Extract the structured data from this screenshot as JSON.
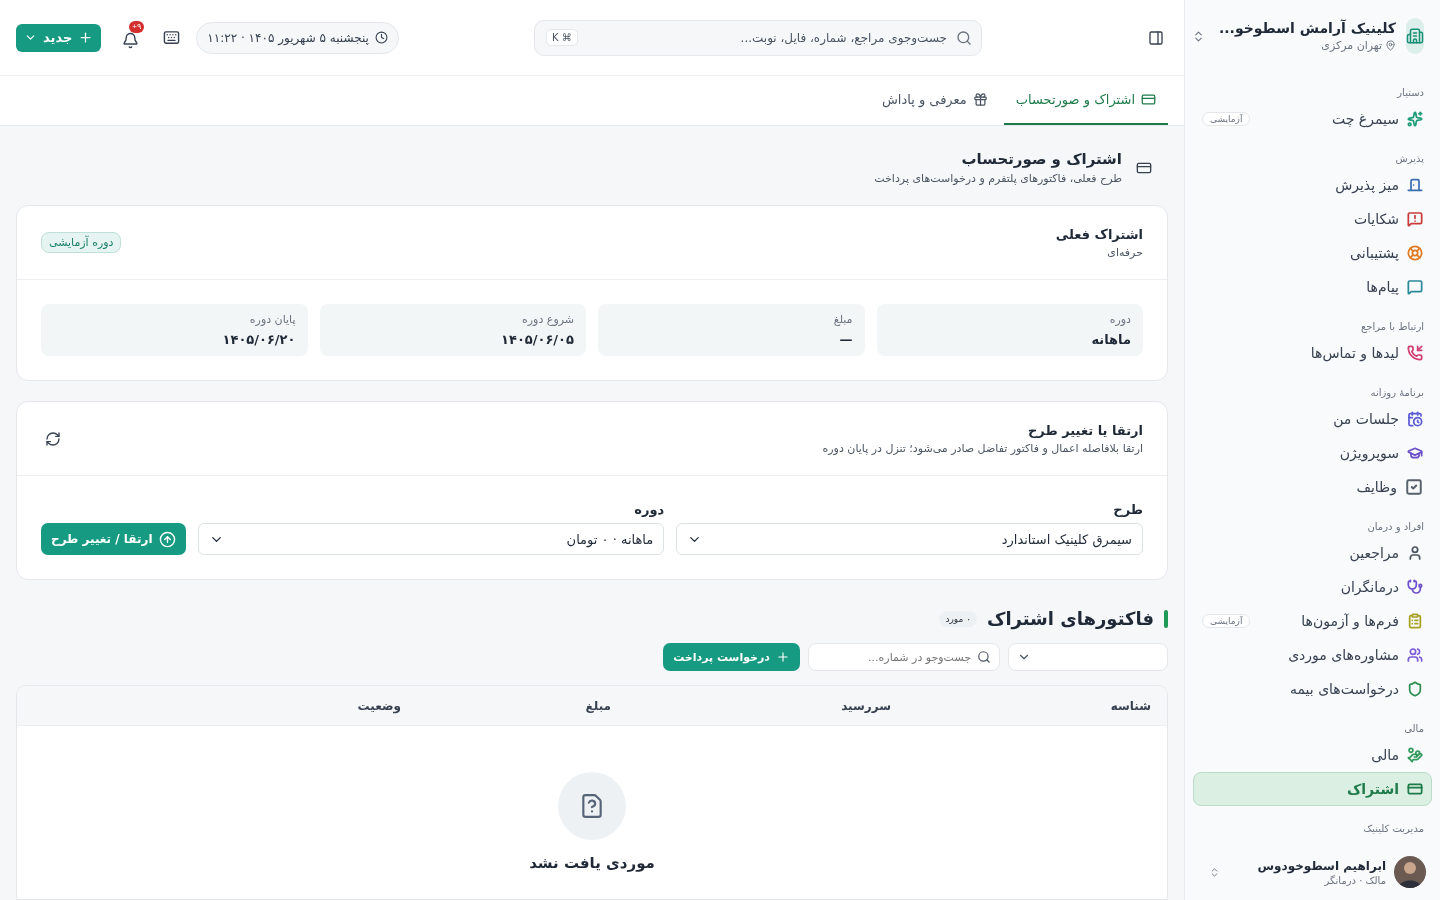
{
  "clinic": {
    "name": "کلینیک آرامش اسطوخو...",
    "location": "تهران مرکزی"
  },
  "sidebar": {
    "sections": [
      {
        "title": "دستیار",
        "items": [
          {
            "label": "سیمرغ چت",
            "badge": "آزمایشی",
            "color": "#1f9d7a",
            "selected": false
          }
        ]
      },
      {
        "title": "پذیرش",
        "items": [
          {
            "label": "میز پذیرش",
            "color": "#3b6fb0",
            "selected": false
          },
          {
            "label": "شکایات",
            "color": "#c93c3c",
            "selected": false
          },
          {
            "label": "پشتیبانی",
            "color": "#e07b24",
            "selected": false
          },
          {
            "label": "پیام‌ها",
            "color": "#2a8a9a",
            "selected": false
          }
        ]
      },
      {
        "title": "ارتباط با مراجع",
        "items": [
          {
            "label": "لیدها و تماس‌ها",
            "color": "#d23c6e",
            "selected": false
          }
        ]
      },
      {
        "title": "برنامهٔ روزانه",
        "items": [
          {
            "label": "جلسات من",
            "color": "#5b5bd6",
            "selected": false
          },
          {
            "label": "سوپرویژن",
            "color": "#6b4fc9",
            "selected": false
          },
          {
            "label": "وظایف",
            "color": "#57606c",
            "selected": false
          }
        ]
      },
      {
        "title": "افراد و درمان",
        "items": [
          {
            "label": "مراجعین",
            "color": "#4b5563",
            "selected": false
          },
          {
            "label": "درمانگران",
            "color": "#6d4fd0",
            "selected": false
          },
          {
            "label": "فرم‌ها و آزمون‌ها",
            "badge": "آزمایشی",
            "color": "#a8a020",
            "selected": false
          },
          {
            "label": "مشاوره‌های موردی",
            "color": "#7c5bd6",
            "selected": false
          },
          {
            "label": "درخواست‌های بیمه",
            "color": "#2f8f4e",
            "selected": false
          }
        ]
      },
      {
        "title": "مالی",
        "items": [
          {
            "label": "مالی",
            "color": "#2f9a5a",
            "selected": false
          },
          {
            "label": "اشتراک",
            "color": "#1e7b4a",
            "selected": true
          }
        ]
      },
      {
        "title": "مدیریت کلینیک"
      }
    ]
  },
  "user": {
    "name": "ابراهیم اسطوخودوس",
    "role": "مالک · درمانگر"
  },
  "topbar": {
    "search_placeholder": "جست‌وجوی مراجع، شماره، فایل، نوبت...",
    "shortcut": "⌘ K",
    "datetime": "پنجشنبه ۵ شهریور ۱۴۰۵ · ۱۱:۲۲",
    "notification_count": "۹+",
    "new_button": "جدید"
  },
  "tabs": [
    {
      "label": "اشتراک و صورتحساب",
      "selected": true
    },
    {
      "label": "معرفی و پاداش",
      "selected": false
    }
  ],
  "page_header": {
    "title": "اشتراک و صورتحساب",
    "subtitle": "طرح فعلی، فاکتورهای پلتفرم و درخواست‌های پرداخت"
  },
  "current_subscription": {
    "title": "اشتراک فعلی",
    "plan": "حرفه‌ای",
    "badge": "دوره آزمایشی",
    "stats": [
      {
        "label": "دوره",
        "value": "ماهانه"
      },
      {
        "label": "مبلغ",
        "value": "—"
      },
      {
        "label": "شروع دوره",
        "value": "۱۴۰۵/۰۶/۰۵"
      },
      {
        "label": "پایان دوره",
        "value": "۱۴۰۵/۰۶/۲۰"
      }
    ]
  },
  "change_plan": {
    "title": "ارتقا یا تغییر طرح",
    "subtitle": "ارتقا بلافاصله اعمال و فاکتور تفاضل صادر می‌شود؛ تنزل در پایان دوره",
    "fields": [
      {
        "label": "طرح",
        "value": "سیمرق کلینیک استاندارد"
      },
      {
        "label": "دوره",
        "value": "ماهانه · ۰ تومان"
      }
    ],
    "button": "ارتقا / تغییر طرح"
  },
  "invoices": {
    "title": "فاکتورهای اشتراک",
    "count": "۰ مورد",
    "search_placeholder": "جست‌وجو در شماره...",
    "button": "درخواست پرداخت",
    "columns": [
      "شناسه",
      "سررسید",
      "مبلغ",
      "وضعیت"
    ],
    "empty_text": "موردی یافت نشد"
  }
}
